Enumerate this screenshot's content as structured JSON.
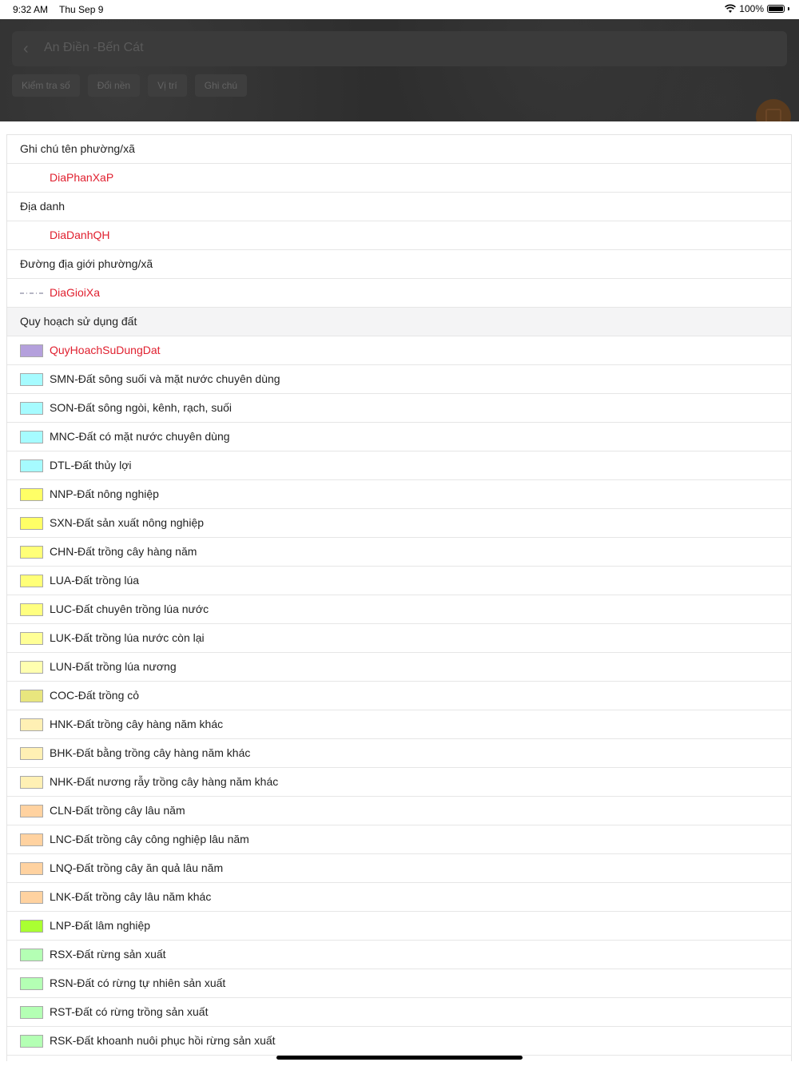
{
  "status_bar": {
    "time": "9:32 AM",
    "date": "Thu Sep 9",
    "battery": "100%"
  },
  "header": {
    "title": "An Điền -Bến Cát",
    "chips": [
      "Kiểm tra số",
      "Đổi nền",
      "Vị trí",
      "Ghi chú"
    ]
  },
  "legend": {
    "sections": {
      "ward_name_note": "Ghi chú tên phường/xã",
      "place_name": "Địa danh",
      "ward_boundary": "Đường địa giới phường/xã",
      "land_use_plan": "Quy hoạch sử dụng đất"
    },
    "layers": {
      "dia_phan_xa": "DiaPhanXaP",
      "dia_danh": "DiaDanhQH",
      "dia_gioi_xa": "DiaGioiXa",
      "quy_hoach": "QuyHoachSuDungDat"
    },
    "items": [
      {
        "label": "SMN-Đất sông suối và mặt nước chuyên dùng",
        "color": "#a6fbff"
      },
      {
        "label": "SON-Đất sông ngòi, kênh, rạch, suối",
        "color": "#a6fbff"
      },
      {
        "label": "MNC-Đất có mặt nước chuyên dùng",
        "color": "#a6fbff"
      },
      {
        "label": "DTL-Đất thủy lợi",
        "color": "#a6fbff"
      },
      {
        "label": "NNP-Đất nông nghiệp",
        "color": "#ffff66"
      },
      {
        "label": "SXN-Đất sản xuất nông nghiệp",
        "color": "#ffff66"
      },
      {
        "label": "CHN-Đất trồng cây hàng năm",
        "color": "#ffff78"
      },
      {
        "label": "LUA-Đất trồng lúa",
        "color": "#ffff78"
      },
      {
        "label": "LUC-Đất chuyên trồng lúa nước",
        "color": "#ffff80"
      },
      {
        "label": "LUK-Đất trồng lúa nước còn lại",
        "color": "#ffff96"
      },
      {
        "label": "LUN-Đất trồng lúa nương",
        "color": "#ffffb0"
      },
      {
        "label": "COC-Đất trồng cỏ",
        "color": "#e8e67e"
      },
      {
        "label": "HNK-Đất trồng cây hàng năm khác",
        "color": "#fff0b4"
      },
      {
        "label": "BHK-Đất bằng trồng cây hàng năm khác",
        "color": "#fff0b4"
      },
      {
        "label": "NHK-Đất nương rẫy trồng cây hàng năm khác",
        "color": "#fff0b4"
      },
      {
        "label": "CLN-Đất trồng cây lâu năm",
        "color": "#ffd2a0"
      },
      {
        "label": "LNC-Đất trồng cây công nghiệp lâu năm",
        "color": "#ffd2a0"
      },
      {
        "label": "LNQ-Đất trồng cây ăn quả lâu năm",
        "color": "#ffd2a0"
      },
      {
        "label": "LNK-Đất trồng cây lâu năm khác",
        "color": "#ffd2a0"
      },
      {
        "label": "LNP-Đất lâm nghiệp",
        "color": "#aaff32"
      },
      {
        "label": "RSX-Đất rừng sản xuất",
        "color": "#b4ffb4"
      },
      {
        "label": "RSN-Đất có rừng tự nhiên sản xuất",
        "color": "#b4ffb4"
      },
      {
        "label": "RST-Đất có rừng trồng sản xuất",
        "color": "#b4ffb4"
      },
      {
        "label": "RSK-Đất khoanh nuôi phục hồi rừng sản xuất",
        "color": "#b4ffb4"
      }
    ],
    "quy_hoach_color": "#b4a0dc"
  }
}
